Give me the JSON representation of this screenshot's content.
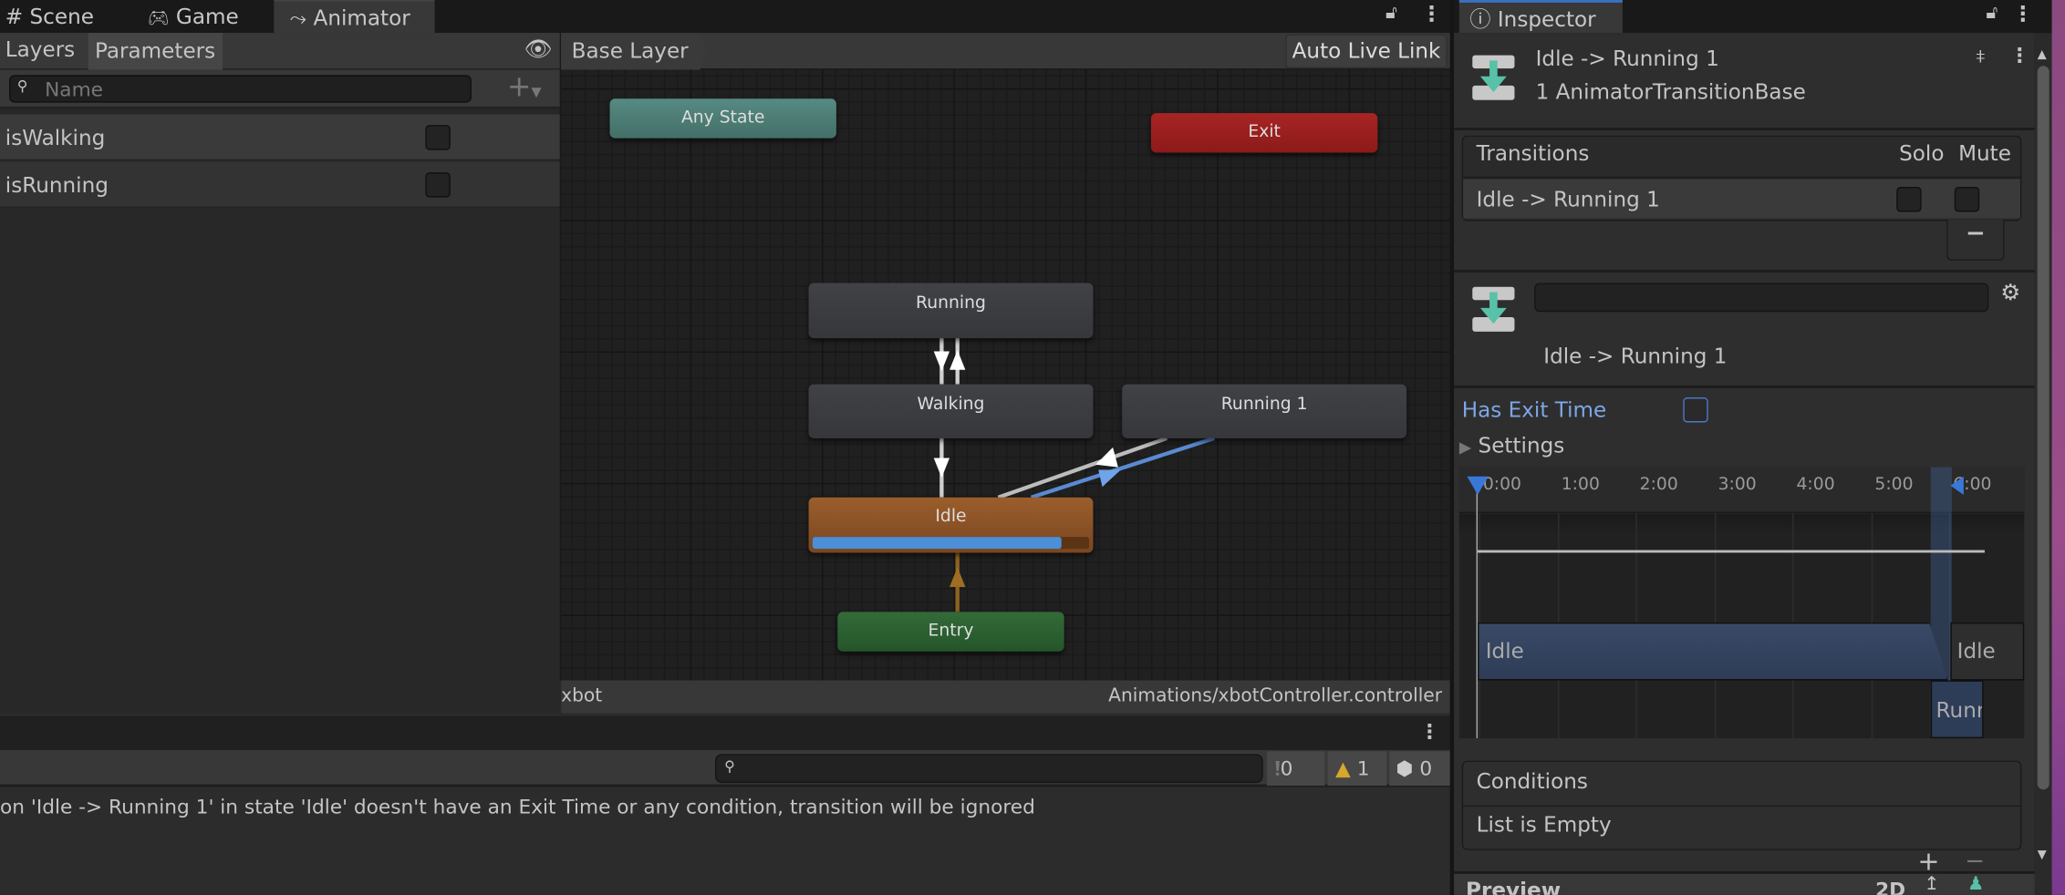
{
  "tabs": {
    "scene": "Scene",
    "game": "Game",
    "animator": "Animator",
    "inspector": "Inspector"
  },
  "animator": {
    "left_tabs": {
      "layers": "Layers",
      "parameters": "Parameters"
    },
    "search_placeholder": "Name",
    "parameters": [
      {
        "name": "isWalking",
        "value": false
      },
      {
        "name": "isRunning",
        "value": false
      }
    ],
    "breadcrumb": "Base Layer",
    "auto_live_link": "Auto Live Link",
    "states": {
      "any": "Any State",
      "exit": "Exit",
      "running": "Running",
      "walking": "Walking",
      "running1": "Running 1",
      "idle": "Idle",
      "entry": "Entry"
    },
    "idle_progress": 0.9,
    "status_left": "xbot",
    "status_right": "Animations/xbotController.controller",
    "colors": {
      "any": "#4d8078",
      "exit": "#9a1f1f",
      "idle": "#93582a",
      "entry": "#2b6a32",
      "selected_transition": "#5a8ad2"
    }
  },
  "console": {
    "search_value": "",
    "counts": {
      "info": "0",
      "warning": "1",
      "error": "0"
    },
    "message": "on 'Idle -> Running 1' in state 'Idle' doesn't have an Exit Time or any condition, transition will be ignored"
  },
  "inspector": {
    "title": "Idle -> Running 1",
    "subtitle": "1 AnimatorTransitionBase",
    "transitions_header": "Transitions",
    "solo": "Solo",
    "mute": "Mute",
    "transition_row": "Idle -> Running 1",
    "remove": "−",
    "name_value": "",
    "transition_label": "Idle -> Running 1",
    "has_exit_time": "Has Exit Time",
    "has_exit_time_value": false,
    "settings": "Settings",
    "timeline_ticks": [
      "0:00",
      "1:00",
      "2:00",
      "3:00",
      "4:00",
      "5:00",
      "6:00"
    ],
    "clip_from": "Idle",
    "clip_from_next": "Idle",
    "clip_to": "Runn",
    "conditions": "Conditions",
    "conditions_empty": "List is Empty",
    "add": "+",
    "preview": "Preview",
    "preview_mode": "2D"
  }
}
